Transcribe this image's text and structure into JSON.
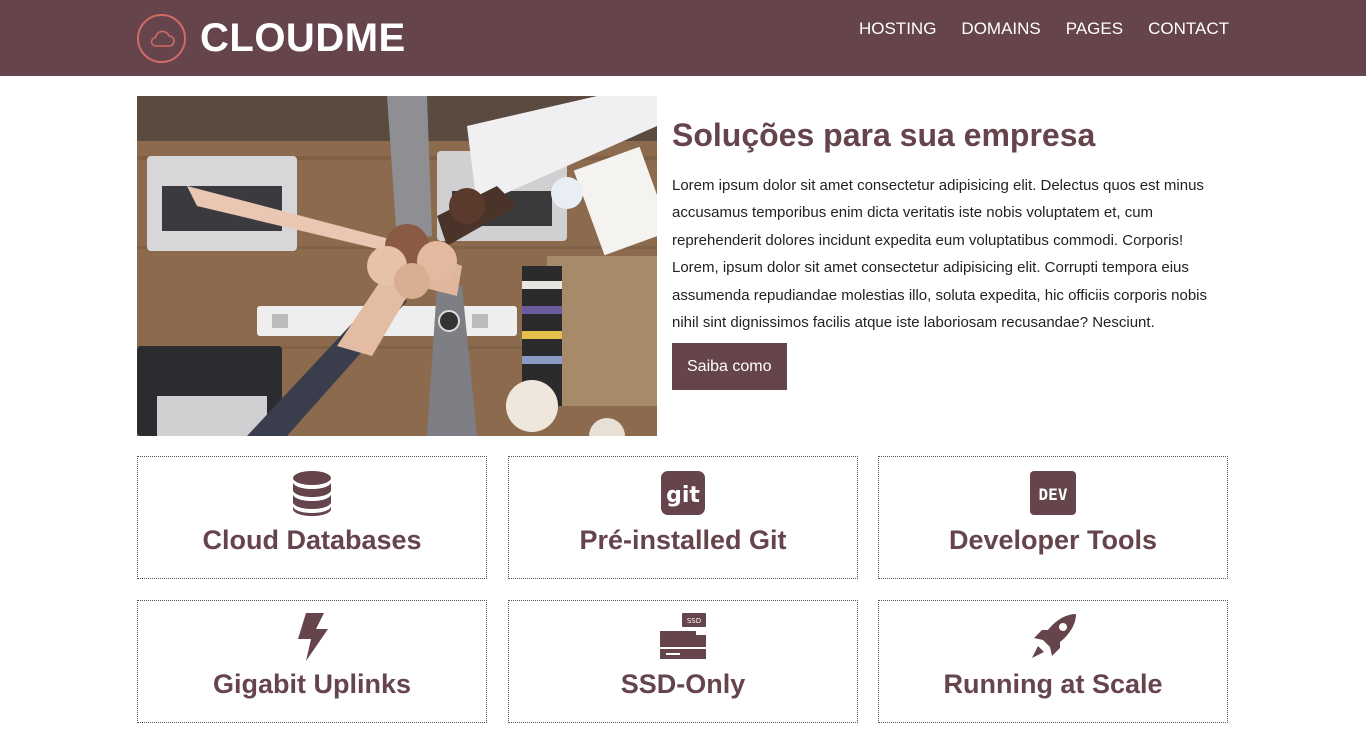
{
  "header": {
    "brand": "CLOUDME",
    "logo_icon": "cloud-icon",
    "nav": [
      "HOSTING",
      "DOMAINS",
      "PAGES",
      "CONTACT"
    ]
  },
  "hero": {
    "image": "teamwork-fist-bump-photo",
    "title": "Soluções para sua empresa",
    "paragraph": "Lorem ipsum dolor sit amet consectetur adipisicing elit. Delectus quos est minus accusamus temporibus enim dicta veritatis iste nobis voluptatem et, cum reprehenderit dolores incidunt expedita eum voluptatibus commodi. Corporis! Lorem, ipsum dolor sit amet consectetur adipisicing elit. Corrupti tempora eius assumenda repudiandae molestias illo, soluta expedita, hic officiis corporis nobis nihil sint dignissimos facilis atque iste laboriosam recusandae? Nesciunt.",
    "button": "Saiba como"
  },
  "features": [
    {
      "label": "Cloud Databases",
      "icon": "database-icon"
    },
    {
      "label": "Pré-installed Git",
      "icon": "git-icon"
    },
    {
      "label": "Developer Tools",
      "icon": "dev-icon"
    },
    {
      "label": "Gigabit Uplinks",
      "icon": "bolt-icon"
    },
    {
      "label": "SSD-Only",
      "icon": "ssd-icon"
    },
    {
      "label": "Running at Scale",
      "icon": "rocket-icon"
    }
  ],
  "colors": {
    "primary": "#65444c",
    "logo_ring": "#d06a64",
    "text": "#222222",
    "background": "#ffffff"
  }
}
